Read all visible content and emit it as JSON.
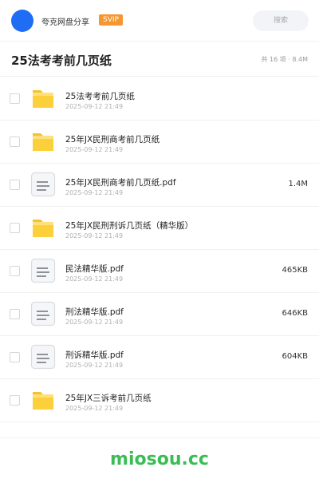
{
  "header": {
    "username": "夸克网盘分享",
    "badge": "SVIP",
    "search_placeholder": "搜索",
    "colors": {
      "avatar": "#1f6cf5",
      "badge": "#f6962f"
    }
  },
  "folder": {
    "title": "25法考考前几页纸",
    "meta": "共 16 项 · 8.4M"
  },
  "files": [
    {
      "type": "folder",
      "icon": "folder-icon",
      "name": "25法考考前几页纸",
      "date": "2025-09-12 21:49",
      "size": ""
    },
    {
      "type": "folder",
      "icon": "folder-icon",
      "name": "25年JX民刑商考前几页纸",
      "date": "2025-09-12 21:49",
      "size": ""
    },
    {
      "type": "pdf",
      "icon": "document-icon",
      "name": "25年JX民刑商考前几页纸.pdf",
      "date": "2025-09-12 21:49",
      "size": "1.4M"
    },
    {
      "type": "folder",
      "icon": "folder-icon",
      "name": "25年JX民刑刑诉几页纸（精华版）",
      "date": "2025-09-12 21:49",
      "size": ""
    },
    {
      "type": "pdf",
      "icon": "document-icon",
      "name": "民法精华版.pdf",
      "date": "2025-09-12 21:49",
      "size": "465KB"
    },
    {
      "type": "pdf",
      "icon": "document-icon",
      "name": "刑法精华版.pdf",
      "date": "2025-09-12 21:49",
      "size": "646KB"
    },
    {
      "type": "pdf",
      "icon": "document-icon",
      "name": "刑诉精华版.pdf",
      "date": "2025-09-12 21:49",
      "size": "604KB"
    },
    {
      "type": "folder",
      "icon": "folder-icon",
      "name": "25年JX三诉考前几页纸",
      "date": "2025-09-12 21:49",
      "size": ""
    }
  ],
  "watermark": "miosou.cc"
}
